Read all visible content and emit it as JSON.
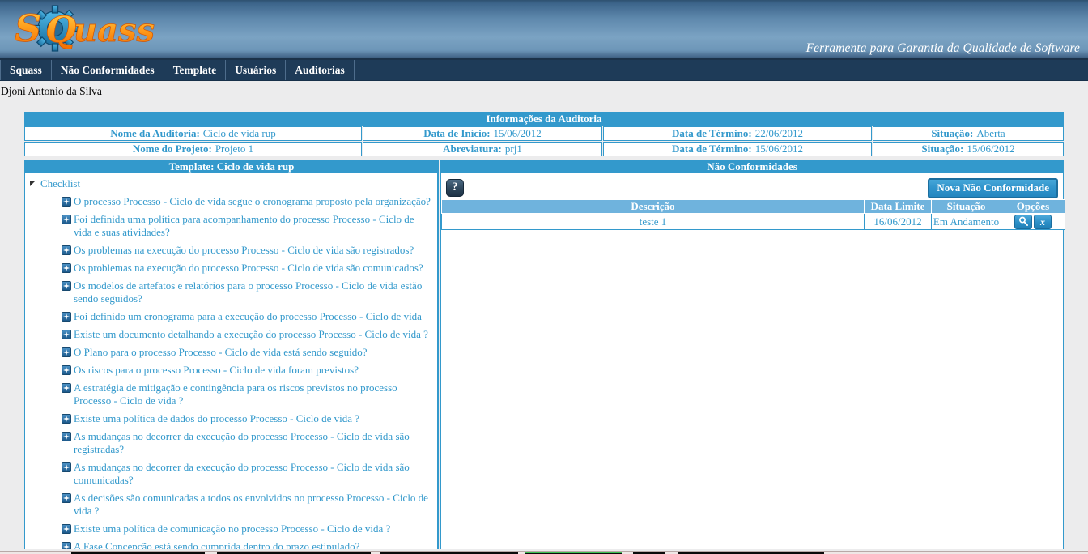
{
  "header": {
    "logo_text": "SQuass",
    "logo_icon": "gear-icon",
    "tagline": "Ferramenta para Garantia da Qualidade de Software",
    "colors": {
      "bar_dark": "#1e3b58",
      "accent": "#3399cc",
      "logo_orange": "#ff9a14"
    }
  },
  "nav": {
    "items": [
      {
        "label": "Squass"
      },
      {
        "label": "Não Conformidades"
      },
      {
        "label": "Template"
      },
      {
        "label": "Usuários"
      },
      {
        "label": "Auditorias"
      }
    ]
  },
  "user": {
    "name": "Djoni Antonio da Silva"
  },
  "audit_info": {
    "band_title": "Informações da Auditoria",
    "row1": [
      {
        "label": "Nome da Auditoria:",
        "value": "Ciclo de vida rup"
      },
      {
        "label": "Data de Início:",
        "value": "15/06/2012"
      },
      {
        "label": "Data de Término:",
        "value": "22/06/2012"
      },
      {
        "label": "Situação:",
        "value": "Aberta"
      }
    ],
    "row2": [
      {
        "label": "Nome do Projeto:",
        "value": "Projeto 1"
      },
      {
        "label": "Abreviatura:",
        "value": "prj1"
      },
      {
        "label": "Data de Término:",
        "value": "15/06/2012"
      },
      {
        "label": "Situação:",
        "value": "15/06/2012"
      }
    ]
  },
  "left_panel": {
    "head": "Template: Ciclo de vida rup",
    "tree_root": "Checklist",
    "items": [
      {
        "text": "O processo Processo - Ciclo de vida segue o cronograma proposto pela organização?"
      },
      {
        "text": "Foi definida uma política para acompanhamento do processo Processo - Ciclo de vida e suas atividades?"
      },
      {
        "text": "Os problemas na execução do processo Processo - Ciclo de vida são registrados?"
      },
      {
        "text": "Os problemas na execução do processo Processo - Ciclo de vida são comunicados?"
      },
      {
        "text": "Os modelos de artefatos e relatórios para o processo Processo - Ciclo de vida estão sendo seguidos?"
      },
      {
        "text": "Foi definido um cronograma para a execução do processo Processo - Ciclo de vida"
      },
      {
        "text": "Existe um documento detalhando a execução do processo Processo - Ciclo de vida ?"
      },
      {
        "text": "O Plano para o processo Processo - Ciclo de vida está sendo seguido?"
      },
      {
        "text": "Os riscos para o processo Processo - Ciclo de vida foram previstos?"
      },
      {
        "text": "A estratégia de mitigação e contingência para os riscos previstos no processo Processo - Ciclo de vida ?"
      },
      {
        "text": "Existe uma política de dados do processo Processo - Ciclo de vida ?"
      },
      {
        "text": "As mudanças no decorrer da execução do processo Processo - Ciclo de vida são registradas?"
      },
      {
        "text": "As mudanças no decorrer da execução do processo Processo - Ciclo de vida são comunicadas?"
      },
      {
        "text": "As decisões são comunicadas a todos os envolvidos no processo Processo - Ciclo de vida ?"
      },
      {
        "text": "Existe uma política de comunicação no processo Processo - Ciclo de vida ?"
      },
      {
        "text": "A Fase Concepção está sendo cumprida dentro do prazo estipulado?"
      }
    ]
  },
  "right_panel": {
    "head": "Não Conformidades",
    "help_icon_label": "?",
    "new_button": "Nova Não Conformidade",
    "table": {
      "columns": [
        "Descrição",
        "Data Limite",
        "Situação",
        "Opções"
      ],
      "rows": [
        {
          "descricao": "teste 1",
          "data_limite": "16/06/2012",
          "situacao": "Em Andamento",
          "options": [
            "magnifier-icon",
            "close-x-icon"
          ]
        }
      ]
    }
  }
}
